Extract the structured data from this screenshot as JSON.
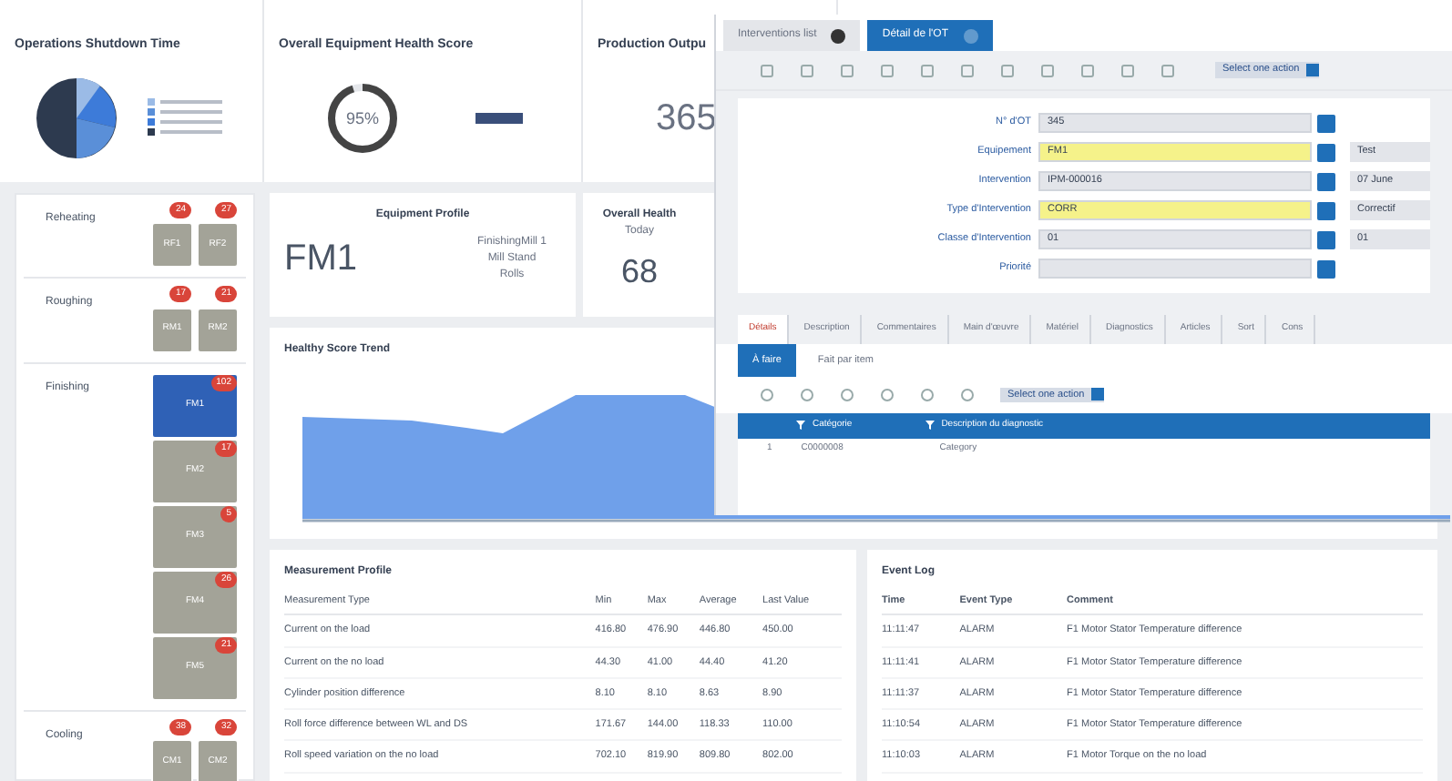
{
  "kpis": [
    {
      "kind": "pie",
      "title": "Operations Shutdown Time"
    },
    {
      "kind": "gauge",
      "title": "Overall Equipment Health Score",
      "reading": "95%",
      "level": 0.95
    },
    {
      "kind": "number",
      "title": "Production Outpu",
      "reading": "365"
    }
  ],
  "lines": [
    {
      "name": "Reheating",
      "equipment": [
        {
          "label": "RF1",
          "count": "24",
          "selected": false
        },
        {
          "label": "RF2",
          "count": "27",
          "selected": false
        }
      ]
    },
    {
      "name": "Roughing",
      "equipment": [
        {
          "label": "RM1",
          "count": "17",
          "selected": false
        },
        {
          "label": "RM2",
          "count": "21",
          "selected": false
        }
      ]
    },
    {
      "name": "Finishing",
      "equipment": [
        {
          "label": "FM1",
          "count": "102",
          "selected": true
        },
        {
          "label": "FM2",
          "count": "17",
          "selected": false
        },
        {
          "label": "FM3",
          "count": "5",
          "selected": false
        },
        {
          "label": "FM4",
          "count": "26",
          "selected": false
        },
        {
          "label": "FM5",
          "count": "21",
          "selected": false
        }
      ]
    },
    {
      "name": "Cooling",
      "equipment": [
        {
          "label": "CM1",
          "count": "38",
          "selected": false
        },
        {
          "label": "CM2",
          "count": "32",
          "selected": false
        }
      ]
    }
  ],
  "profile": {
    "title": "Equipment Profile",
    "code": "FM1",
    "details": [
      "FinishingMill 1",
      "Mill Stand",
      "Rolls"
    ],
    "health_title": "Overall Health",
    "health_sub": "Today",
    "health_value": "68"
  },
  "trend": {
    "title": "Healthy Score Trend"
  },
  "measurements": {
    "title": "Measurement Profile",
    "columns": [
      "Measurement Type",
      "Min",
      "Max",
      "Average",
      "Last Value"
    ],
    "rows": [
      [
        "Current on the load",
        "416.80",
        "476.90",
        "446.80",
        "450.00"
      ],
      [
        "Current on the no load",
        "44.30",
        "41.00",
        "44.40",
        "41.20"
      ],
      [
        "Cylinder position difference",
        "8.10",
        "8.10",
        "8.63",
        "8.90"
      ],
      [
        "Roll force difference between WL and DS",
        "171.67",
        "144.00",
        "118.33",
        "110.00"
      ],
      [
        "Roll speed variation on the no load",
        "702.10",
        "819.90",
        "809.80",
        "802.00"
      ]
    ]
  },
  "events": {
    "title": "Event Log",
    "columns": [
      "Time",
      "Event Type",
      "Comment"
    ],
    "rows": [
      [
        "11:11:47",
        "ALARM",
        "F1 Motor Stator Temperature difference"
      ],
      [
        "11:11:41",
        "ALARM",
        "F1 Motor Stator Temperature difference"
      ],
      [
        "11:11:37",
        "ALARM",
        "F1 Motor Stator Temperature difference"
      ],
      [
        "11:10:54",
        "ALARM",
        "F1 Motor Stator Temperature difference"
      ],
      [
        "11:10:03",
        "ALARM",
        "F1 Motor Torque on the no load"
      ]
    ]
  },
  "window": {
    "tabs": [
      {
        "label": "Interventions list",
        "selected": false
      },
      {
        "label": "Détail de l'OT",
        "selected": true
      }
    ],
    "action_select": "Select one action",
    "fields": [
      {
        "label": "N° d'OT",
        "value": "345",
        "required": false
      },
      {
        "label": "Equipement",
        "value": "FM1",
        "required": true,
        "side": "Test"
      },
      {
        "label": "Intervention",
        "value": "IPM-000016",
        "required": false,
        "side": "07 June"
      },
      {
        "label": "Type d'Intervention",
        "value": "CORR",
        "required": true,
        "side": "Correctif"
      },
      {
        "label": "Classe d'Intervention",
        "value": "01",
        "required": false,
        "side": "01"
      },
      {
        "label": "Priorité",
        "required": false
      }
    ],
    "section_tabs": [
      {
        "label": "Détails",
        "selected": true
      },
      {
        "label": "Description",
        "selected": false
      },
      {
        "label": "Commentaires",
        "selected": false
      },
      {
        "label": "Main d'œuvre",
        "selected": false
      },
      {
        "label": "Matériel",
        "selected": false
      },
      {
        "label": "Diagnostics",
        "selected": false
      },
      {
        "label": "Articles",
        "selected": false
      },
      {
        "label": "Sort",
        "selected": false
      },
      {
        "label": "Cons",
        "selected": false
      }
    ],
    "sub_tabs": [
      {
        "label": "À faire",
        "selected": true
      },
      {
        "label": "Fait par item",
        "selected": false
      }
    ],
    "sub_action_select": "Select one action",
    "grid_columns": [
      "Catégorie",
      "Description du diagnostic"
    ],
    "grid_rows": [
      [
        "1",
        "C0000008",
        "Category"
      ]
    ]
  }
}
